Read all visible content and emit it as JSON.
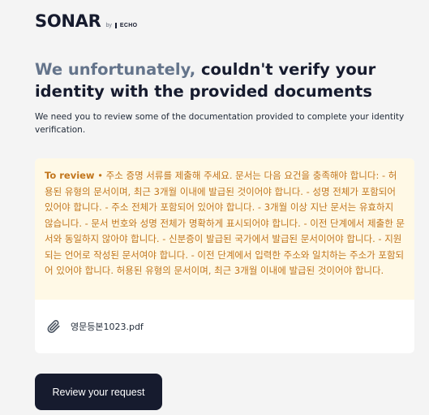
{
  "brand": {
    "name": "SONAR",
    "by": "by",
    "partner": "ECHO"
  },
  "headline": {
    "muted": "We unfortunately,",
    "strong": " couldn't verify your identity with the provided documents"
  },
  "description": "We need you to review some of the documentation provided to complete your identity verification.",
  "review": {
    "label": "To review",
    "separator": " • ",
    "text": "주소 증명 서류를 제출해 주세요. 문서는 다음 요건을 충족해야 합니다: - 허용된 유형의 문서이며, 최근 3개월 이내에 발급된 것이어야 합니다. - 성명 전체가 포함되어 있어야 합니다. - 주소 전체가 포함되어 있어야 합니다. - 3개월 이상 지난 문서는 유효하지 않습니다. - 문서 번호와 성명 전체가 명확하게 표시되어야 합니다. - 이전 단계에서 제출한 문서와 동일하지 않아야 합니다. - 신분증이 발급된 국가에서 발급된 문서이어야 합니다. - 지원되는 언어로 작성된 문서여야 합니다. - 이전 단계에서 입력한 주소와 일치하는 주소가 포함되어 있어야 합니다. 허용된 유형의 문서이며, 최근 3개월 이내에 발급된 것이어야 합니다."
  },
  "attachment": {
    "icon": "paperclip-icon",
    "file_name": "영문등본1023.pdf"
  },
  "cta": {
    "label": "Review your request"
  },
  "colors": {
    "brand_dark": "#161b2e",
    "muted_heading": "#64748b",
    "review_bg": "#fff9e6",
    "review_text": "#c2761d"
  }
}
